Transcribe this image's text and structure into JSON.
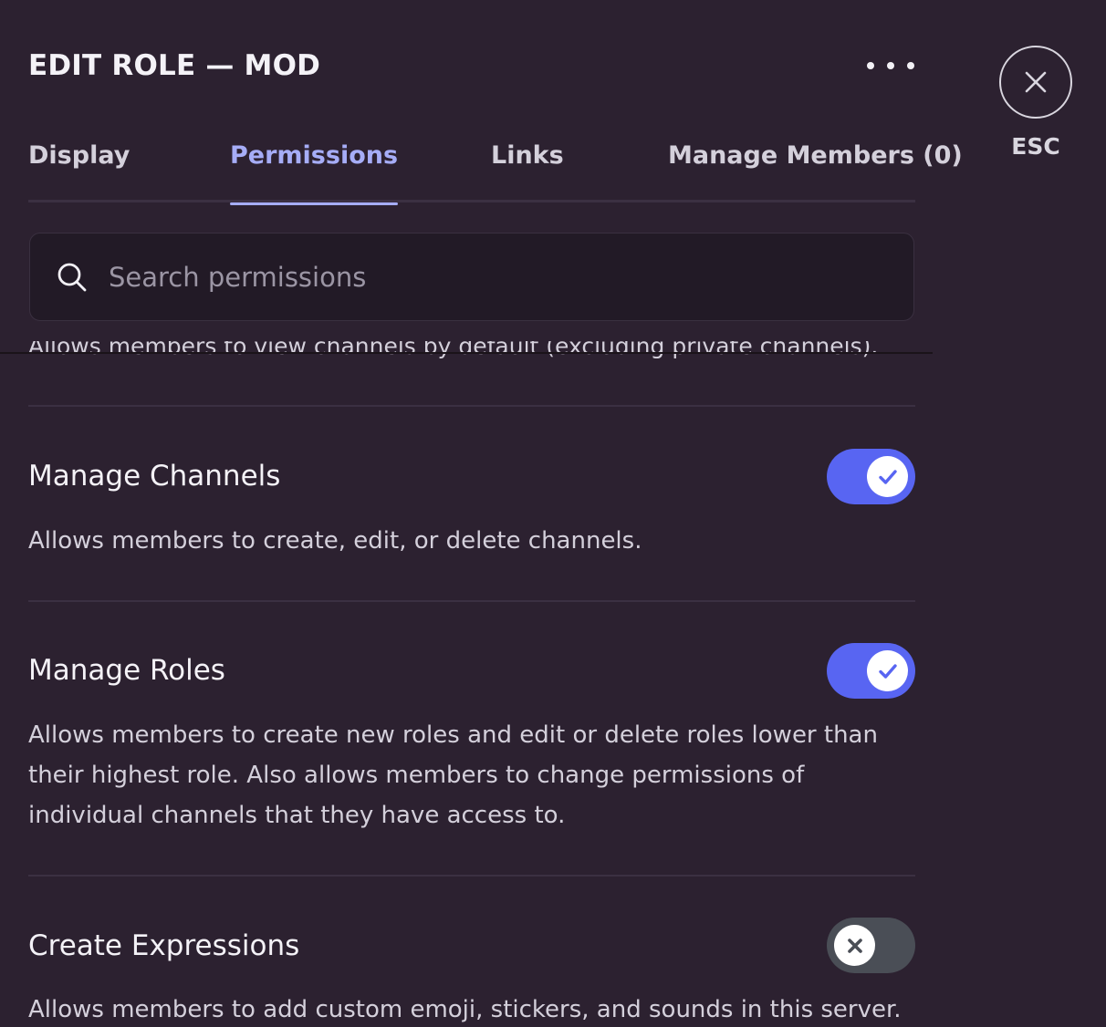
{
  "header": {
    "title": "EDIT ROLE — MOD",
    "more_icon": "more-horizontal-icon",
    "close_icon": "close-icon",
    "close_label": "ESC"
  },
  "tabs": [
    {
      "label": "Display",
      "active": false
    },
    {
      "label": "Permissions",
      "active": true
    },
    {
      "label": "Links",
      "active": false
    },
    {
      "label": "Manage Members (0)",
      "active": false
    }
  ],
  "search": {
    "placeholder": "Search permissions",
    "value": "",
    "icon": "search-icon"
  },
  "partial_description": "Allows members to view channels by default (excluding private channels).",
  "permissions": [
    {
      "name": "Manage Channels",
      "description": "Allows members to create, edit, or delete channels.",
      "enabled": true
    },
    {
      "name": "Manage Roles",
      "description": "Allows members to create new roles and edit or delete roles lower than their highest role. Also allows members to change permissions of individual channels that they have access to.",
      "enabled": true
    },
    {
      "name": "Create Expressions",
      "description": "Allows members to add custom emoji, stickers, and sounds in this server.",
      "enabled": false
    }
  ],
  "colors": {
    "background": "#2c2130",
    "accent": "#5865f2",
    "active_tab": "#a6adf7",
    "toggle_off": "#4a4e56"
  }
}
